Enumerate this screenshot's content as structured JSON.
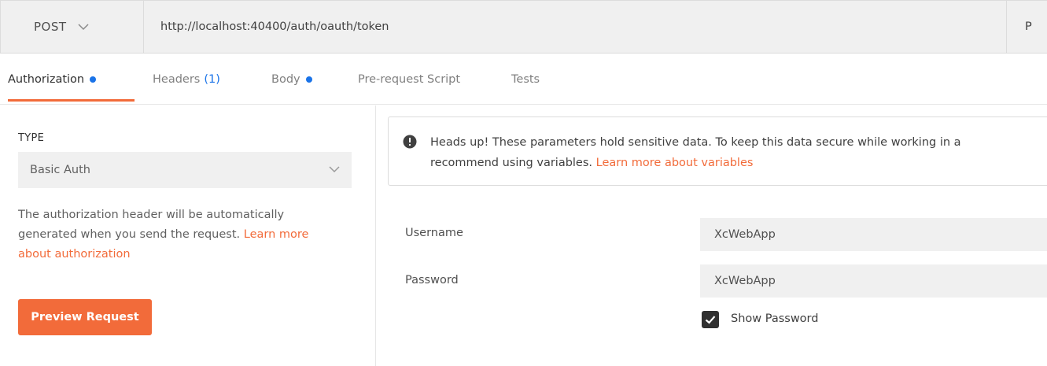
{
  "request": {
    "method": "POST",
    "url": "http://localhost:40400/auth/oauth/token",
    "params_label": "P"
  },
  "tabs": [
    {
      "label": "Authorization",
      "active": true,
      "indicator": "dot"
    },
    {
      "label": "Headers",
      "count": "(1)"
    },
    {
      "label": "Body",
      "indicator": "dot"
    },
    {
      "label": "Pre-request Script"
    },
    {
      "label": "Tests"
    }
  ],
  "auth": {
    "type_label": "TYPE",
    "type_value": "Basic Auth",
    "description": "The authorization header will be automatically generated when you send the request.",
    "description_link": "Learn more about authorization",
    "preview_button": "Preview Request"
  },
  "alert": {
    "icon": "info-icon",
    "text_line1": "Heads up! These parameters hold sensitive data. To keep this data secure while working in a",
    "text_line2": "recommend using variables.",
    "link": "Learn more about variables"
  },
  "fields": {
    "username_label": "Username",
    "username_value": "XcWebApp",
    "password_label": "Password",
    "password_value": "XcWebApp",
    "show_password_label": "Show Password",
    "show_password_checked": true
  },
  "colors": {
    "accent": "#f26b3a",
    "dot": "#1a73e8",
    "input_bg": "#f0f0f0"
  }
}
